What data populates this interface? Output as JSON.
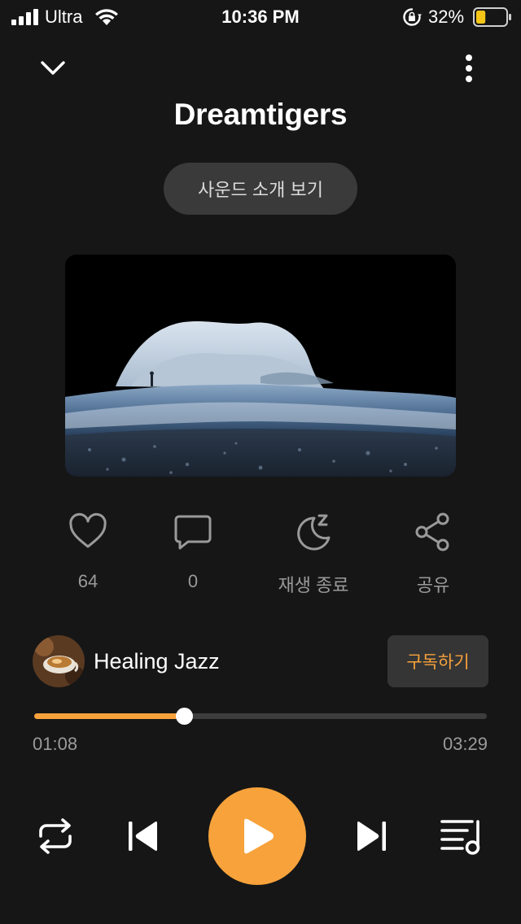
{
  "status_bar": {
    "carrier": "Ultra",
    "time": "10:36 PM",
    "battery_percent": "32%",
    "battery_level": 0.32,
    "battery_color": "#f5c518",
    "icons": [
      "signal-icon",
      "wifi-icon",
      "orientation-lock-icon",
      "battery-icon"
    ]
  },
  "header": {
    "collapse_icon": "chevron-down-icon",
    "more_icon": "more-vertical-icon",
    "title": "Dreamtigers",
    "intro_button": "사운드 소개 보기"
  },
  "actions": {
    "like": {
      "icon": "heart-icon",
      "label": "64"
    },
    "comment": {
      "icon": "comment-icon",
      "label": "0"
    },
    "sleep_timer": {
      "icon": "sleep-moon-icon",
      "label": "재생 종료"
    },
    "share": {
      "icon": "share-icon",
      "label": "공유"
    }
  },
  "channel": {
    "name": "Healing Jazz",
    "subscribe_label": "구독하기"
  },
  "progress": {
    "current": "01:08",
    "total": "03:29",
    "fraction": 0.331
  },
  "controls": {
    "icons": [
      "repeat-icon",
      "previous-icon",
      "play-icon",
      "next-icon",
      "queue-icon"
    ]
  },
  "colors": {
    "background": "#161616",
    "accent": "#f7a23b",
    "muted_text": "#9a9a9a",
    "button_bg": "#3a3a3a"
  }
}
